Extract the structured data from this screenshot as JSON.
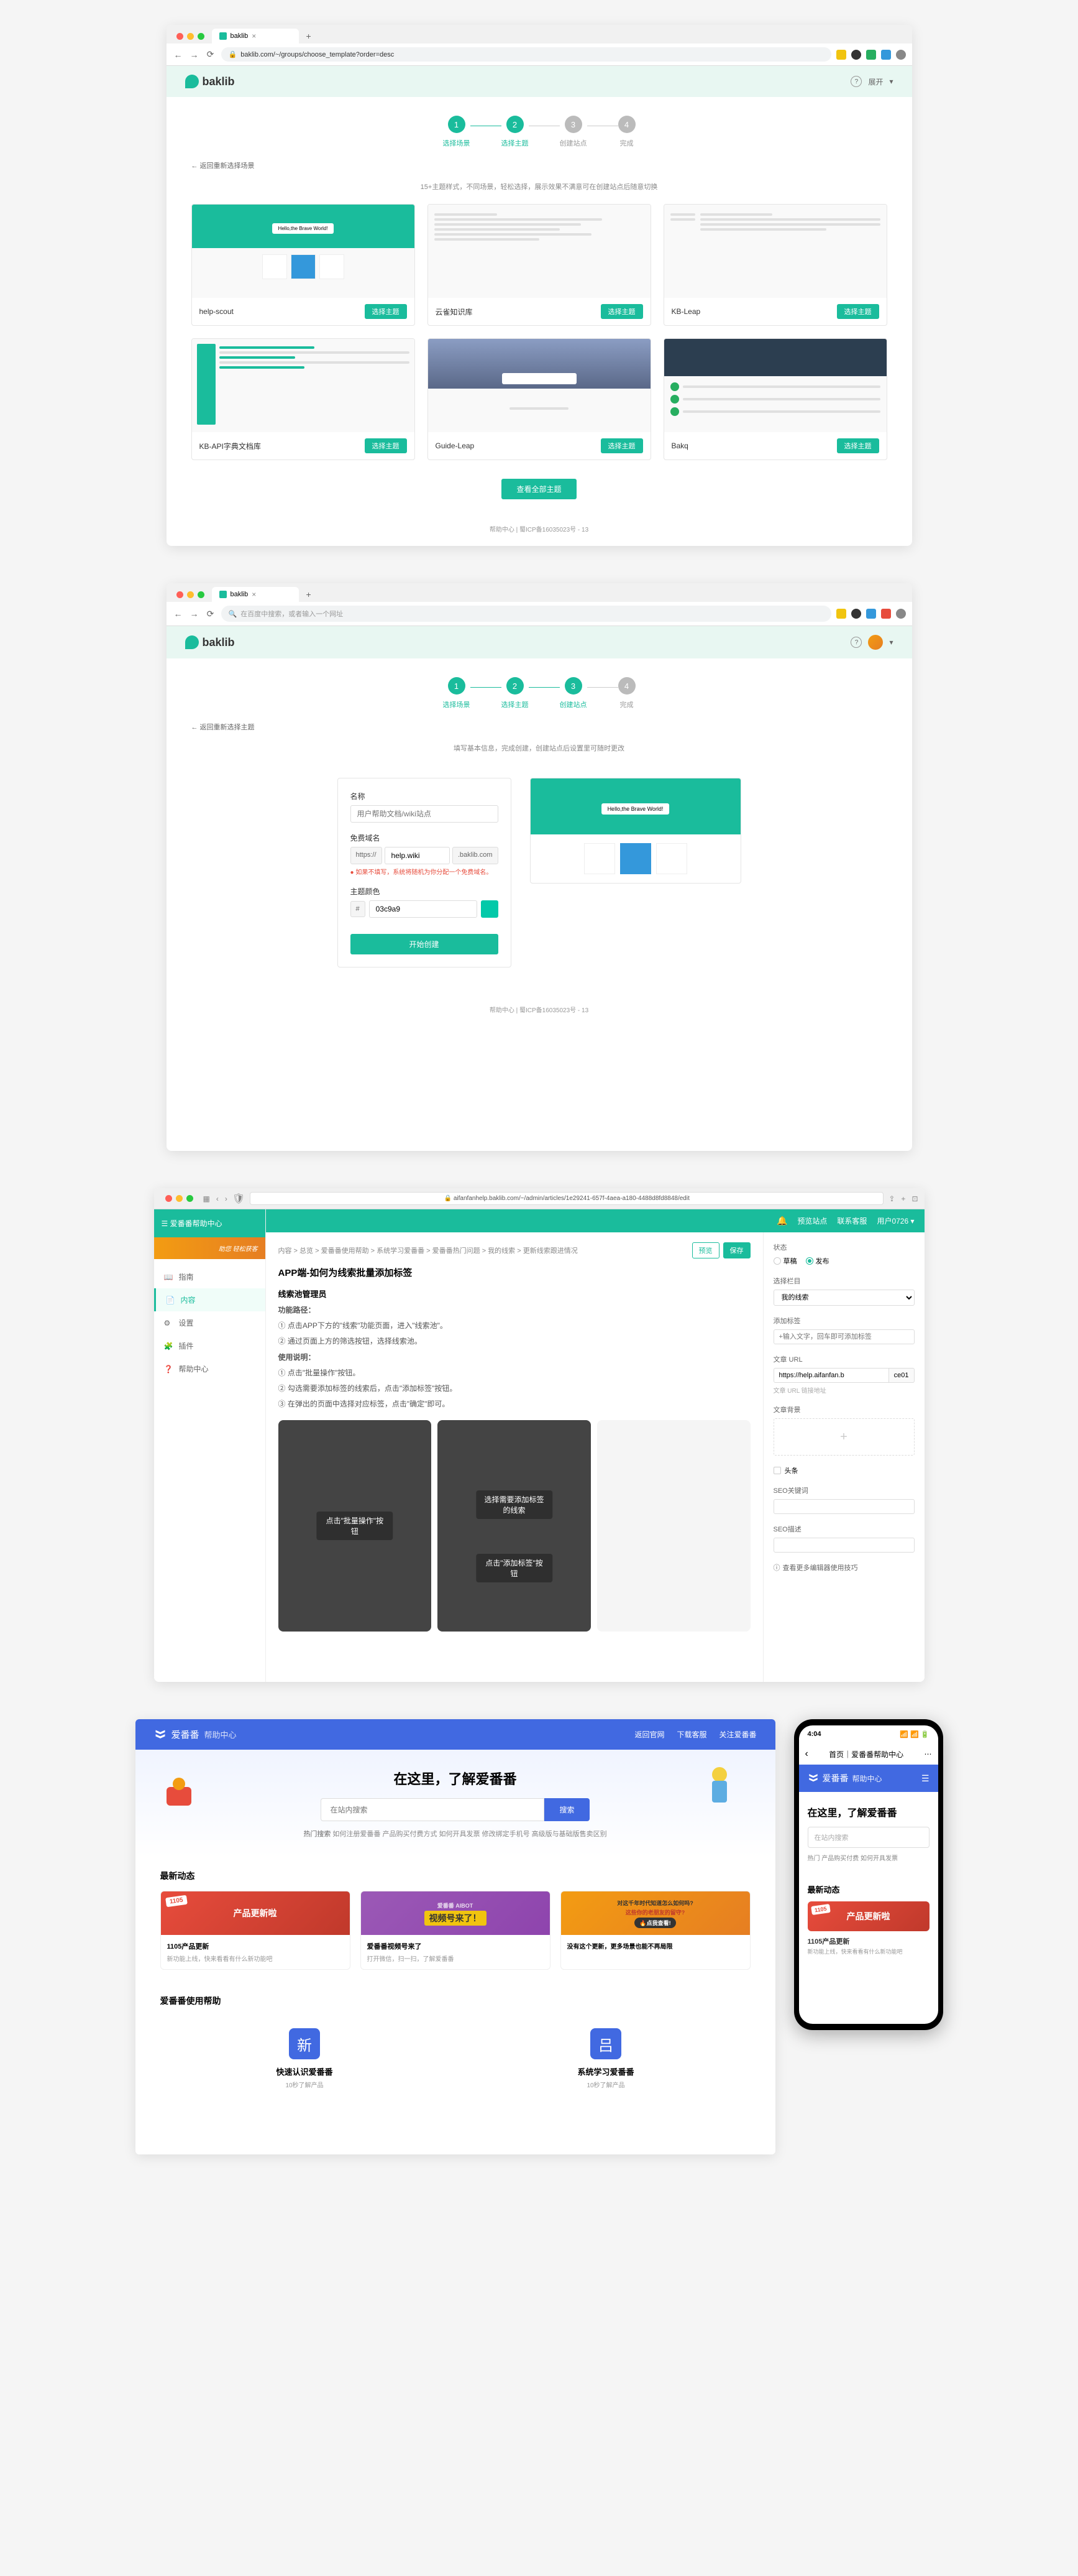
{
  "browser1": {
    "tab_title": "baklib",
    "url": "baklib.com/~/groups/choose_template?order=desc",
    "url_placeholder": "",
    "logo": "baklib",
    "header_user": "展开",
    "steps": [
      "选择场景",
      "选择主题",
      "创建站点",
      "完成"
    ],
    "back": "← 返回重新选择场景",
    "desc": "15+主题样式，不同场景，轻松选择，展示效果不满意可在创建站点后随意切换",
    "templates": [
      {
        "name": "help-scout",
        "btn": "选择主题",
        "bubble": "Hello,the Brave World!"
      },
      {
        "name": "云雀知识库",
        "btn": "选择主题"
      },
      {
        "name": "KB-Leap",
        "btn": "选择主题"
      },
      {
        "name": "KB-API字典文档库",
        "btn": "选择主题"
      },
      {
        "name": "Guide-Leap",
        "btn": "选择主题"
      },
      {
        "name": "Bakq",
        "btn": "选择主题"
      }
    ],
    "view_all": "查看全部主题",
    "footer": "帮助中心 | 蜀ICP备16035023号 - 13"
  },
  "browser2": {
    "tab_title": "baklib",
    "url_placeholder": "在百度中搜索，或者输入一个网址",
    "logo": "baklib",
    "steps": [
      "选择场景",
      "选择主题",
      "创建站点",
      "完成"
    ],
    "back": "← 返回重新选择主题",
    "desc": "填写基本信息，完成创建，创建站点后设置里可随时更改",
    "form": {
      "name_label": "名称",
      "name_placeholder": "用户帮助文档/wiki站点",
      "domain_label": "免费域名",
      "domain_prefix": "https://",
      "domain_value": "help.wiki",
      "domain_suffix": ".baklib.com",
      "domain_hint": "● 如果不填写，系统将随机为你分配一个免费域名。",
      "color_label": "主题颜色",
      "color_prefix": "#",
      "color_value": "03c9a9",
      "create_btn": "开始创建"
    },
    "preview_bubble": "Hello,the Brave World!",
    "footer": "帮助中心 | 蜀ICP备16035023号 - 13"
  },
  "browser3": {
    "url": "aifanfanhelp.baklib.com/~/admin/articles/1e29241-657f-4aea-a180-4488d8fd8848/edit",
    "brand_title": "爱番番帮助中心",
    "brand_sub": "助您 轻松获客",
    "nav": [
      {
        "icon": "book",
        "label": "指南"
      },
      {
        "icon": "doc",
        "label": "内容"
      },
      {
        "icon": "gear",
        "label": "设置"
      },
      {
        "icon": "plugin",
        "label": "插件"
      },
      {
        "icon": "help",
        "label": "帮助中心"
      }
    ],
    "topbar": {
      "preview": "预览站点",
      "contact": "联系客服",
      "user": "用户0726"
    },
    "breadcrumb": "内容 > 总览 > 爱番番使用帮助 > 系统学习爱番番 > 爱番番热门问题 > 我的线索 > 更新线索跟进情况",
    "btn_preview": "预览",
    "btn_save": "保存",
    "article": {
      "title": "APP端-如何为线索批量添加标签",
      "h2_1": "线索池管理员",
      "p_path": "功能路径：",
      "p1": "① 点击APP下方的\"线索\"功能页面，进入\"线索池\"。",
      "p2": "② 通过页面上方的筛选按钮，选择线索池。",
      "p_usage": "使用说明：",
      "p3": "① 点击\"批量操作\"按钮。",
      "p4": "② 勾选需要添加标签的线索后，点击\"添加标签\"按钮。",
      "p5": "③ 在弹出的页面中选择对应标签，点击\"确定\"即可。",
      "shot1": "点击\"批量操作\"按钮",
      "shot2a": "选择需要添加标签的线索",
      "shot2b": "点击\"添加标签\"按钮"
    },
    "right": {
      "status_label": "状态",
      "status_draft": "草稿",
      "status_publish": "发布",
      "col_label": "选择栏目",
      "col_value": "我的线索",
      "tag_label": "添加标签",
      "tag_placeholder": "+输入文字，回车即可添加标签",
      "url_label": "文章 URL",
      "url_prefix": "https://help.aifanfan.b",
      "url_value": "ce01",
      "url_hint": "文章 URL 链接地址",
      "bg_label": "文章背景",
      "headline_label": "头条",
      "seo_kw_label": "SEO关键词",
      "seo_desc_label": "SEO描述",
      "tips": "查看更多编辑器使用技巧"
    }
  },
  "helpcenter": {
    "logo": "爱番番",
    "logo_sub": "帮助中心",
    "nav": [
      "返回官网",
      "下载客服",
      "关注爱番番"
    ],
    "hero_title": "在这里，了解爱番番",
    "search_placeholder": "在站内搜索",
    "search_btn": "搜索",
    "tags_label": "热门搜索",
    "tags": "如何注册爱番番 产品购买付费方式 如何开具发票 修改绑定手机号 高级版与基础版售卖区别",
    "news_title": "最新动态",
    "cards": [
      {
        "badge": "1105",
        "banner": "产品更新啦",
        "title": "1105产品更新",
        "desc": "新功能上线，快来看看有什么新功能吧"
      },
      {
        "banner": "视频号来了！",
        "banner_sub": "爱番番 AIBOT",
        "title": "爱番番视频号来了",
        "desc": "打开微信，扫一扫，了解爱番番"
      },
      {
        "banner_top": "对这千年时代知道怎么如何吗?",
        "banner_main": "这些你的老朋友的留守?",
        "banner_btn": "🔥点我查看!",
        "title": "没有这个更新，更多场景也能不再局限",
        "desc": ""
      }
    ],
    "help_title": "爱番番使用帮助",
    "help_items": [
      {
        "icon": "新",
        "title": "快速认识爱番番",
        "desc": "10秒了解产品"
      },
      {
        "icon": "吕",
        "title": "系统学习爱番番",
        "desc": "10秒了解产品"
      }
    ]
  },
  "mobile": {
    "time": "4:04",
    "nav_title": "首页｜爱番番帮助中心",
    "logo": "爱番番",
    "logo_sub": "帮助中心",
    "hero_title": "在这里，了解爱番番",
    "search_placeholder": "在站内搜索",
    "tags_label": "热门",
    "tags": "产品购买付费    如何开具发票",
    "news_title": "最新动态",
    "banner_badge": "1105",
    "banner_text": "产品更新啦",
    "banner_sub": "1105产品更新",
    "banner_desc": "新功能上线，快来看看有什么新功能吧"
  }
}
